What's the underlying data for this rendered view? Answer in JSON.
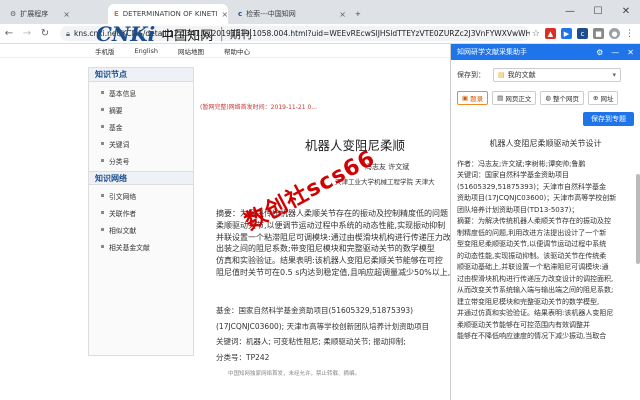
{
  "tabs": [
    {
      "label": "扩展程序",
      "icon": "puzzle-icon"
    },
    {
      "label": "DETERMINATION OF KINETI",
      "icon": "document-icon"
    },
    {
      "label": "检索---中国知网",
      "icon": "cnki-icon"
    }
  ],
  "window_controls": {
    "minimize": "—",
    "maximize": "☐",
    "close": "✕"
  },
  "address": {
    "url": "kns.cnki.net/KCMS/detail/12.1341.ts.20191119.1058.004.html?uid=WEEvREcwSlJHSldTTEYzVTE0ZURZc2J3VnFYWXVwWHFFZzhrNXEjKensW4ggl8..."
  },
  "topnav": [
    "手机版",
    "English",
    "网站地图",
    "帮助中心"
  ],
  "logo": {
    "brand": "CNKi",
    "chinese": "中国知网",
    "section": "期刊"
  },
  "tagline": "(暂网完整)网络首发时间：2019-11-21 0...",
  "sidebar": {
    "section1": "知识节点",
    "items1": [
      "基本信息",
      "摘要",
      "基金",
      "关键词",
      "分类号"
    ],
    "section2": "知识网络",
    "items2": [
      "引文网络",
      "关联作者",
      "相似文献",
      "相关基金文献"
    ]
  },
  "article": {
    "title": "机器人变阻尼柔顺",
    "authors": "冯志友  许文斌",
    "org": "天津工业大学机械工程学院    天津大"
  },
  "abstract_lines": [
    "摘要：为解决传统机器人柔顺关节存在的振动及控制精度低的问题",
    "柔顺驱动关节,以便调节运动过程中系统的动态性能,实现振动抑制",
    "并联设置一个粘滞阻尼可调模块:通过由楔滑块机构进行传递压力改",
    "出装之间的阻尼系数;带变阻尼模块和完整驱动关节的数学模型",
    "仿真和实验验证。结果表明:该机器人变阻尼柔顺关节能够在可控",
    "阻尼值时关节可在0.5 s内达到稳定值,且响应超调量减少50%以上,"
  ],
  "fund": "基金：国家自然科学基金资助项目(51605329,51875393)",
  "fund2": "(17JCQNJC03600); 天津市高等学校创新团队培养计划资助项目",
  "keywords": "关键词：机器人; 可变粘性阻尼; 柔顺驱动关节; 振动抑制;",
  "classno": "分类号：TP242",
  "small_note": "中国知网独家网络首发，未经允许，禁止转载、摘编。",
  "watermark": "数创社scs66",
  "panel": {
    "header": "知网研学文献采集助手",
    "controls": {
      "settings": "⚙",
      "minimize": "—",
      "close": "✕"
    },
    "save_to_label": "保存到：",
    "save_to_value": "我的文献",
    "buttons": [
      {
        "label": "题录",
        "icon": "bookmark-icon",
        "highlight": true
      },
      {
        "label": "网页正文",
        "icon": "page-icon",
        "highlight": false
      },
      {
        "label": "整个网页",
        "icon": "globe-icon",
        "highlight": false
      },
      {
        "label": "网址",
        "icon": "link-icon",
        "highlight": false
      }
    ],
    "save_special": "保存到专题",
    "doc_title": "机器人变阻尼柔顺驱动关节设计",
    "lines": [
      "作者：冯志友;许文斌;李树彬;谭奕帅;鲁鹏",
      "关键词：国家自然科学基金资助项目",
      "(51605329,51875393)；天津市自然科学基金",
      "资助项目(17JCQNJC03600)；天津市高等学校创新",
      "团队培养计划资助项目(TD13-5037)；",
      "摘要：为解决传统机器人柔顺关节存在的振动及控",
      "制精度低的问题,利用改进方法提出设计了一个新",
      "型变阻尼柔顺驱动关节,以便调节运动过程中系统",
      "的动态性能,实现振动抑制。该驱动关节在传统柔",
      "顺驱动基础上,并联设置一个粘滞阻尼可调模块:通",
      "过由楔滑块机构进行传递压力改变设计的调控面积,",
      "从而改变关节系统输入端与输出端之间的阻尼系数;",
      "建立带变阻尼模块和完整驱动关节的数学模型,",
      "并通过仿真和实验验证。结果表明:该机器人变阻尼",
      "柔顺驱动关节能够在可控范围内有效调整并",
      "能够在不降低响应速度的情况下减少振动,当取合"
    ]
  },
  "colors": {
    "accent": "#1e74e8",
    "brand": "#1c4d8c",
    "watermark": "#d20000",
    "highlight": "#f08a24"
  }
}
